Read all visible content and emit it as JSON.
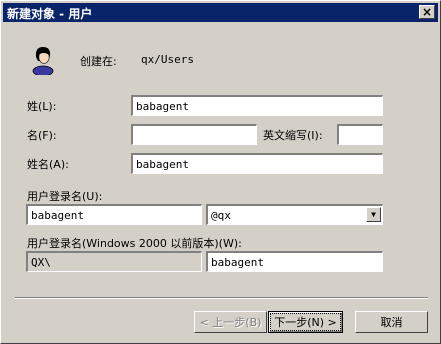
{
  "window": {
    "title": "新建对象 - 用户",
    "close_glyph": "×"
  },
  "header": {
    "created_in_label": "创建在:",
    "created_in_value": "qx/Users"
  },
  "form": {
    "last_name_label": "姓(L):",
    "last_name_value": "babagent",
    "first_name_label": "名(F):",
    "first_name_value": "",
    "initials_label": "英文缩写(I):",
    "initials_value": "",
    "full_name_label": "姓名(A):",
    "full_name_value": "babagent",
    "logon_name_label": "用户登录名(U):",
    "logon_name_value": "babagent",
    "upn_suffix_value": "@qx",
    "pre2000_label": "用户登录名(Windows 2000 以前版本)(W):",
    "pre2000_domain_value": "QX\\",
    "pre2000_name_value": "babagent"
  },
  "buttons": {
    "back_label": "< 上一步(B)",
    "next_label": "下一步(N) >",
    "cancel_label": "取消"
  },
  "icons": {
    "user": "user-icon",
    "close": "close-icon",
    "dropdown": "chevron-down-icon"
  }
}
